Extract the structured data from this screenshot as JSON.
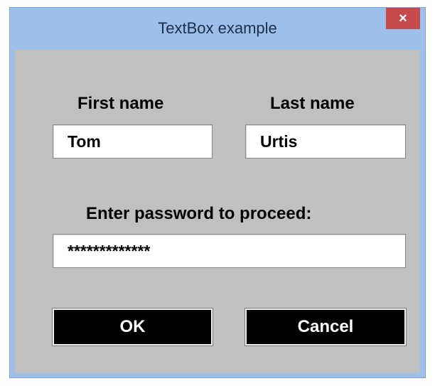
{
  "window": {
    "title": "TextBox example",
    "close_glyph": "×",
    "title_bar_color": "#9cc0ea",
    "close_button_color": "#c74a4a",
    "client_background": "#c0c0c0"
  },
  "form": {
    "first_name_label": "First name",
    "first_name_value": "Tom",
    "last_name_label": "Last name",
    "last_name_value": "Urtis",
    "password_label": "Enter password to proceed:",
    "password_value": "*************"
  },
  "buttons": {
    "ok_label": "OK",
    "cancel_label": "Cancel"
  }
}
